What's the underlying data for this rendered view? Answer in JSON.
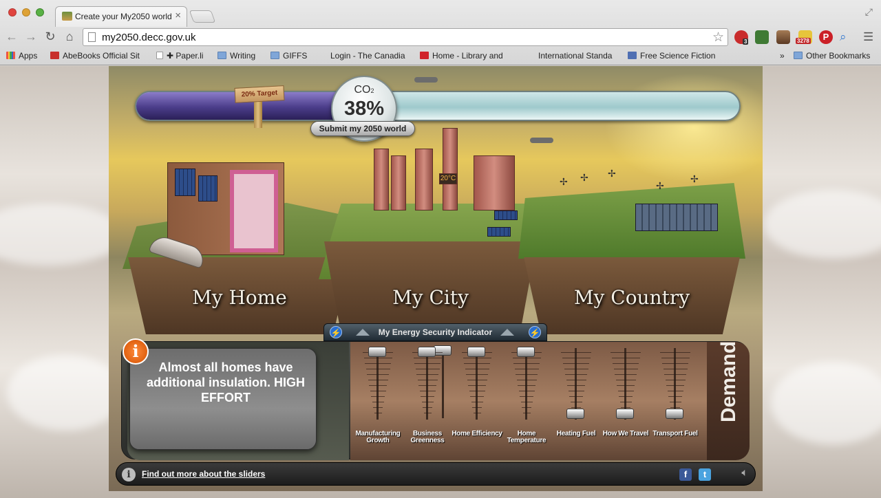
{
  "browser": {
    "tab_title": "Create your My2050 world",
    "url": "my2050.decc.gov.uk",
    "ext_badge_1": "3",
    "ext_badge_2": "3278",
    "bookmarks": [
      "Apps",
      "AbeBooks Official Sit",
      "Paper.li",
      "Writing",
      "GIFFS",
      "Login - The Canadia",
      "Home - Library and",
      "International Standa",
      "Free Science Fiction"
    ],
    "bookmarks_more": "»",
    "other_bookmarks": "Other Bookmarks"
  },
  "game": {
    "target_label": "20% Target",
    "co2_label": "CO",
    "co2_sub": "2",
    "co2_value": "38%",
    "co2_progress": 0.38,
    "target_progress": 0.2,
    "submit_label": "Submit my 2050 world",
    "islands": [
      "My Home",
      "My City",
      "My Country"
    ],
    "energy_indicator": "My Energy Security Indicator",
    "info_icon": "i",
    "info_text": "Almost all homes have additional insulation. HIGH EFFORT",
    "demand_label": "Demand",
    "sliders": [
      {
        "label": "Manufacturing Growth",
        "level": 4
      },
      {
        "label": "Business Greenness",
        "level": 4
      },
      {
        "label": "Home Efficiency",
        "level": 4
      },
      {
        "label": "Home Temperature",
        "level": 4
      },
      {
        "label": "Heating Fuel",
        "level": 1
      },
      {
        "label": "How We Travel",
        "level": 1
      },
      {
        "label": "Transport Fuel",
        "level": 1
      }
    ],
    "find_out_more": "Find out more about the sliders",
    "temp_display": "20°C",
    "facebook": "f",
    "twitter": "t"
  }
}
